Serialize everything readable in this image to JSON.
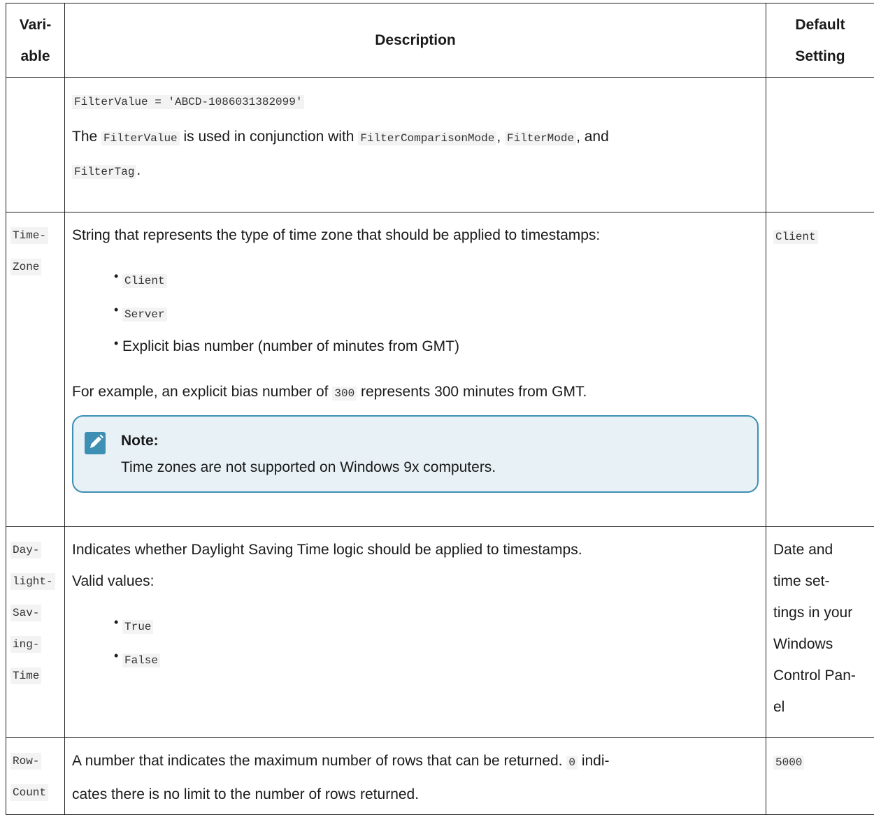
{
  "headers": {
    "variable": "Vari-\nable",
    "description": "Description",
    "default": "Default\nSetting"
  },
  "row0": {
    "code_line": "FilterValue = 'ABCD-1086031382099'",
    "text_the": "The",
    "code_filtervalue": "FilterValue",
    "text_used": "is used in conjunction with",
    "code_comparison": "FilterComparisonMode",
    "comma1": ",",
    "code_filtermode": "FilterMode",
    "text_and": ", and",
    "code_filtertag": "FilterTag",
    "period": "."
  },
  "row1": {
    "var_parts": [
      "Time-",
      "Zone"
    ],
    "intro": "String that represents the type of time zone that should be applied to timestamps:",
    "bullets": {
      "client": "Client",
      "server": "Server",
      "explicit": "Explicit bias number (number of minutes from GMT)"
    },
    "example_pre": "For example, an explicit bias number of",
    "example_code": "300",
    "example_post": "represents 300 minutes from GMT.",
    "note_title": "Note:",
    "note_body": "Time zones are not supported on Windows 9x computers.",
    "default": "Client"
  },
  "row2": {
    "var_parts": [
      "Day-",
      "light-",
      "Sav-",
      "ing-",
      "Time"
    ],
    "line1": "Indicates whether Daylight Saving Time logic should be applied to timestamps.",
    "line2": "Valid values:",
    "bullets": {
      "true": "True",
      "false": "False"
    },
    "default_lines": [
      "Date and",
      "time set-",
      "tings in your",
      "Windows",
      "Control Pan-",
      "el"
    ]
  },
  "row3": {
    "var_parts": [
      "Row-",
      "Count"
    ],
    "text_pre": "A number that indicates the maximum number of rows that can be returned.",
    "code_zero": "0",
    "text_post_line1": "indi-",
    "text_line2": "cates there is no limit to the number of rows returned.",
    "default": "5000"
  },
  "icons": {
    "note": "pencil-note-icon"
  },
  "colors": {
    "note_border": "#3d8fb3",
    "note_bg": "#e7f1f6",
    "code_bg": "#f3f3f3"
  }
}
